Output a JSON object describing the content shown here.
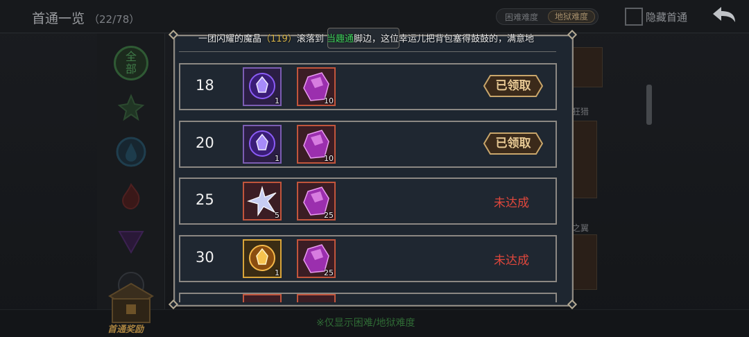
{
  "header": {
    "title": "首通一览",
    "count": "（22/78）",
    "difficulty_hard": "困难难度",
    "difficulty_hell": "地狱难度",
    "hide_label": "隐藏首通"
  },
  "filters": {
    "all_label": "全部"
  },
  "side_cards": {
    "label_1": "狂猎",
    "label_2": "之翼"
  },
  "footer": {
    "chest_label": "首通奖励",
    "note": "※仅显示困难/地狱难度"
  },
  "banner": {
    "prefix": "一团闪耀的魔晶",
    "number": "（119）",
    "mid": "滚落到",
    "player": "当趣通",
    "suffix": "脚边，这位幸运儿把背包塞得鼓鼓的，满意地"
  },
  "rows": [
    {
      "level": "18",
      "item1": {
        "icon": "purple-token-icon",
        "qty": "1"
      },
      "item2": {
        "icon": "purple-crystal-icon",
        "qty": "10"
      },
      "status": "已领取"
    },
    {
      "level": "20",
      "item1": {
        "icon": "purple-token-icon",
        "qty": "1"
      },
      "item2": {
        "icon": "purple-crystal-icon",
        "qty": "10"
      },
      "status": "已领取"
    },
    {
      "level": "25",
      "item1": {
        "icon": "silver-star-icon",
        "qty": "5"
      },
      "item2": {
        "icon": "purple-crystal-icon",
        "qty": "25"
      },
      "status": "未达成"
    },
    {
      "level": "30",
      "item1": {
        "icon": "gold-token-icon",
        "qty": "1"
      },
      "item2": {
        "icon": "purple-crystal-icon",
        "qty": "25"
      },
      "status": "未达成"
    }
  ],
  "colors": {
    "claimed_text": "#e6c893",
    "unachieved_text": "#e0473c",
    "player_name": "#3fd35c",
    "number_highlight": "#d8b54a"
  }
}
